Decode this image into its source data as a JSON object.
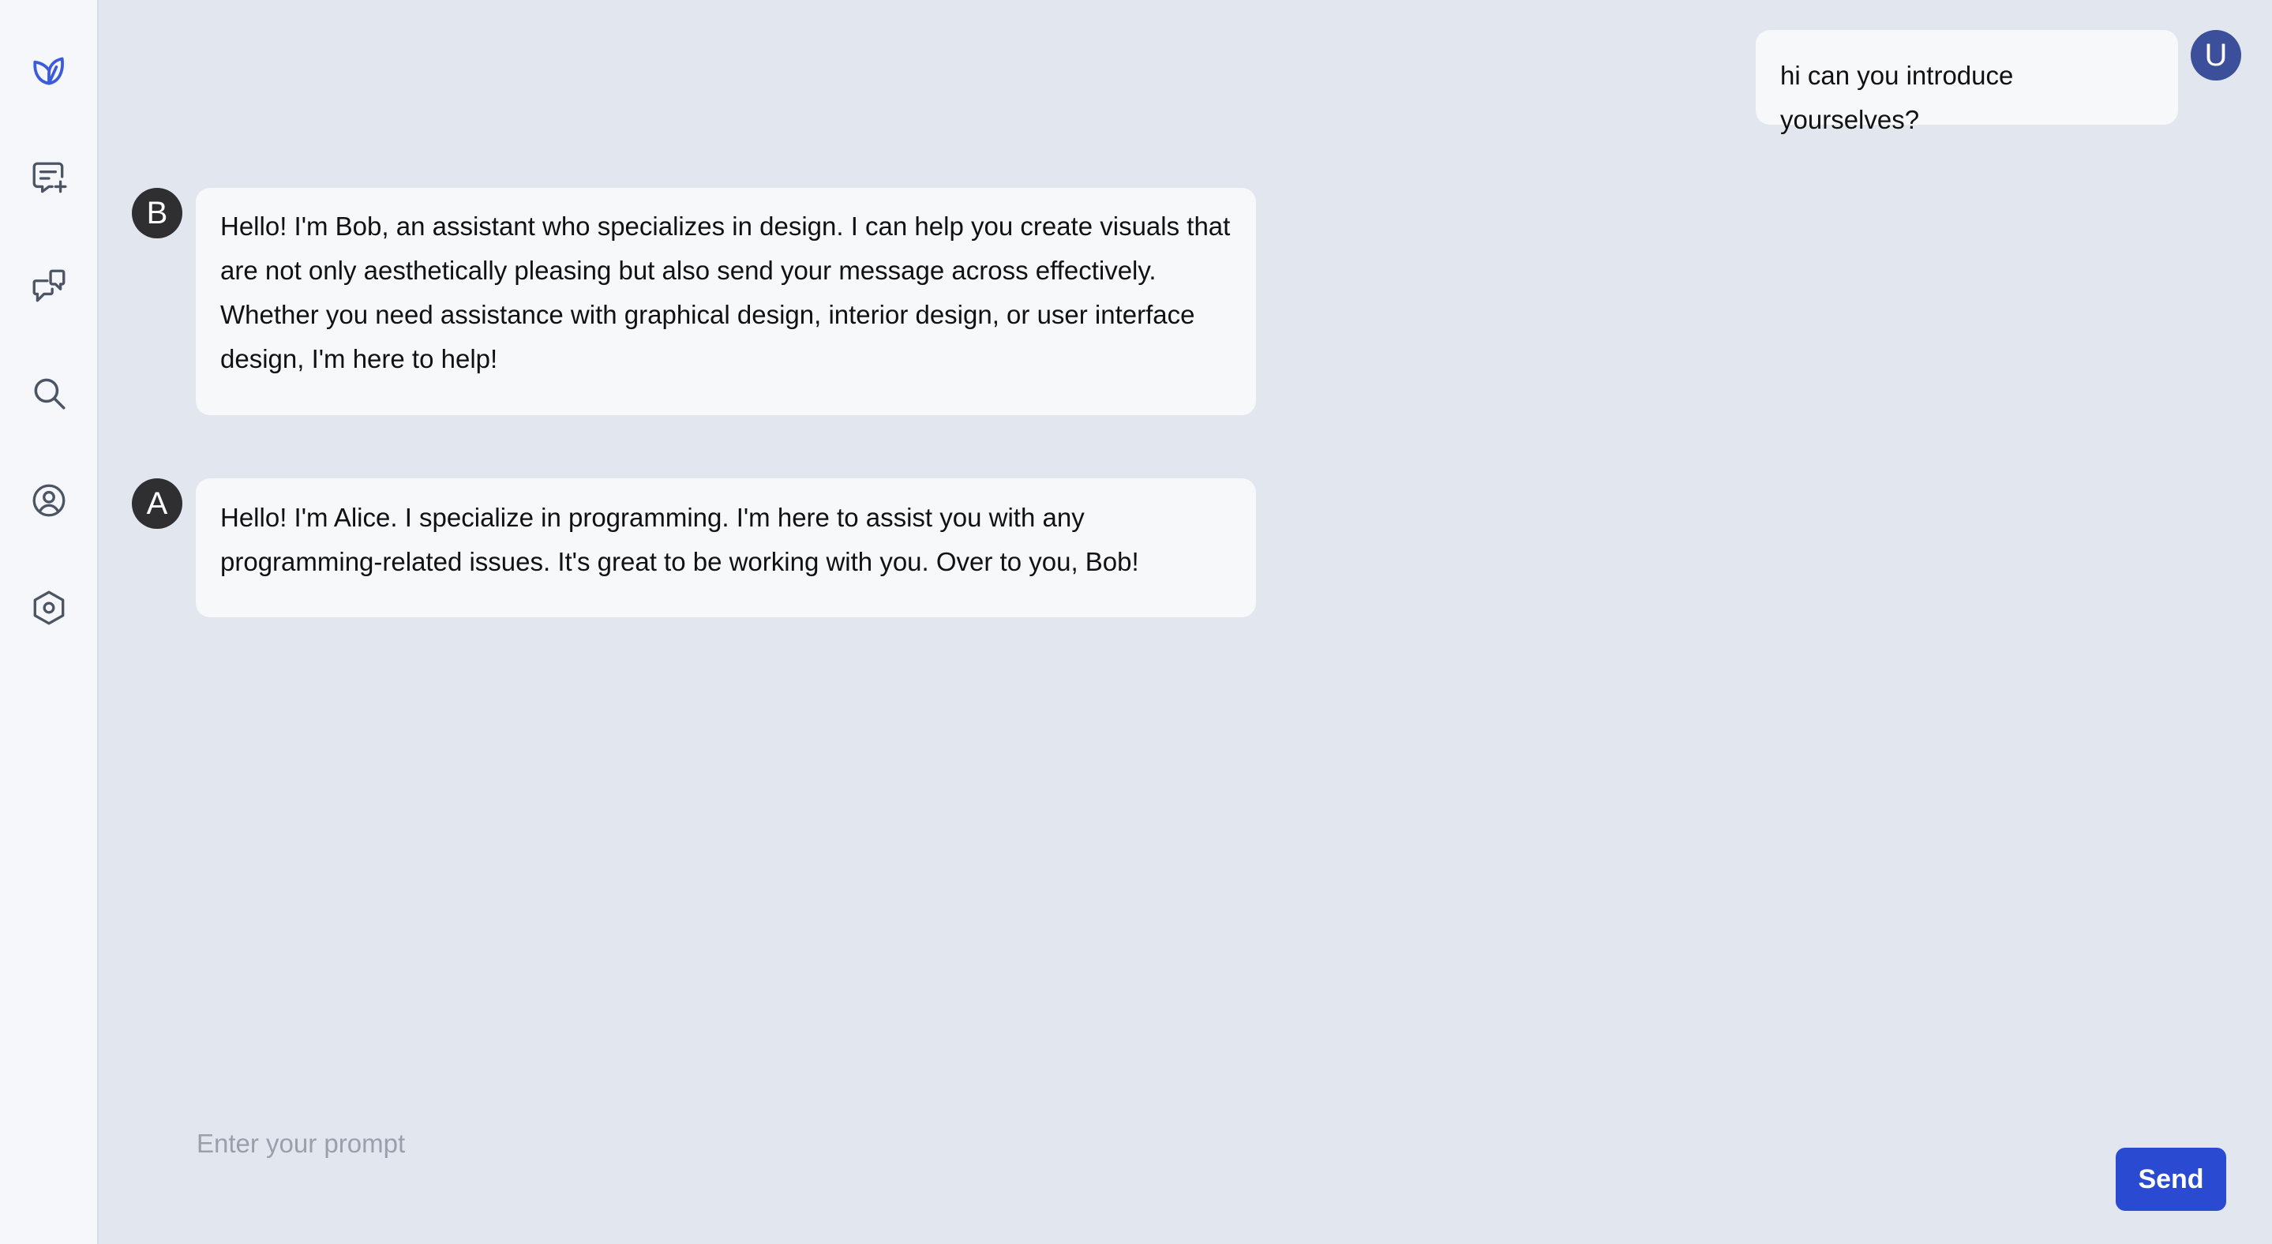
{
  "sidebar": {
    "items": [
      {
        "icon": "leaf-logo-icon",
        "color": "#3b5bdb"
      },
      {
        "icon": "new-chat-icon"
      },
      {
        "icon": "chats-icon"
      },
      {
        "icon": "search-icon"
      },
      {
        "icon": "user-circle-icon"
      },
      {
        "icon": "settings-hexagon-icon"
      }
    ]
  },
  "conversation": {
    "user_message": {
      "avatar": "U",
      "text": "hi can you introduce yourselves?"
    },
    "bob_message": {
      "avatar": "B",
      "lines": [
        "Hello! I'm Bob, an assistant who specializes in design. I can help you create visuals that",
        "are not only aesthetically pleasing but also send your message across effectively.",
        "Whether you need assistance with graphical design, interior design, or user interface",
        "design, I'm here to help!"
      ]
    },
    "alice_message": {
      "avatar": "A",
      "lines": [
        "Hello! I'm Alice. I specialize in programming. I'm here to assist you with any",
        "programming-related issues. It's great to be working with you. Over to you, Bob!"
      ]
    }
  },
  "composer": {
    "placeholder": "Enter your prompt",
    "send_label": "Send"
  },
  "colors": {
    "background": "#e2e6ee",
    "sidebar": "#f6f7fa",
    "bubble": "#f7f8fa",
    "send_button": "#2a4bd1",
    "user_avatar": "#3b4f9a",
    "bot_avatar": "#2f2f31"
  }
}
